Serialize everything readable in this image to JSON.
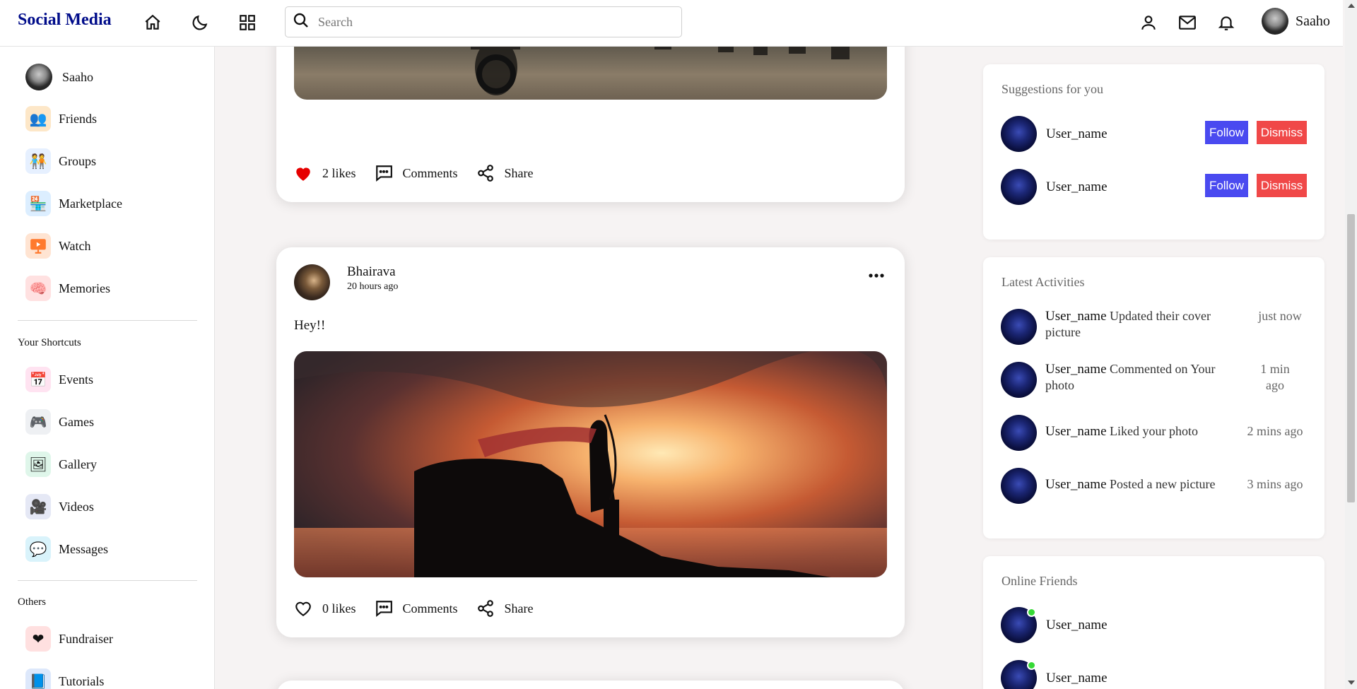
{
  "app": {
    "logo": "Social Media"
  },
  "search": {
    "placeholder": "Search"
  },
  "header_user": {
    "name": "Saaho"
  },
  "sidebar": {
    "profile": {
      "name": "Saaho"
    },
    "main_items": [
      {
        "label": "Friends",
        "icon": "friends-icon"
      },
      {
        "label": "Groups",
        "icon": "groups-icon"
      },
      {
        "label": "Marketplace",
        "icon": "marketplace-icon"
      },
      {
        "label": "Watch",
        "icon": "watch-icon"
      },
      {
        "label": "Memories",
        "icon": "memories-icon"
      }
    ],
    "shortcuts_heading": "Your Shortcuts",
    "shortcuts": [
      {
        "label": "Events",
        "icon": "events-icon"
      },
      {
        "label": "Games",
        "icon": "games-icon"
      },
      {
        "label": "Gallery",
        "icon": "gallery-icon"
      },
      {
        "label": "Videos",
        "icon": "videos-icon"
      },
      {
        "label": "Messages",
        "icon": "messages-icon"
      }
    ],
    "others_heading": "Others",
    "others": [
      {
        "label": "Fundraiser",
        "icon": "fundraiser-icon"
      },
      {
        "label": "Tutorials",
        "icon": "tutorials-icon"
      }
    ]
  },
  "posts": [
    {
      "likes": "2 likes",
      "liked": true,
      "comments_label": "Comments",
      "share_label": "Share"
    },
    {
      "author": "Bhairava",
      "time": "20 hours ago",
      "text": "Hey!!",
      "likes": "0 likes",
      "liked": false,
      "comments_label": "Comments",
      "share_label": "Share"
    }
  ],
  "suggestions": {
    "title": "Suggestions for you",
    "items": [
      {
        "name": "User_name",
        "follow": "Follow",
        "dismiss": "Dismiss"
      },
      {
        "name": "User_name",
        "follow": "Follow",
        "dismiss": "Dismiss"
      }
    ]
  },
  "activities": {
    "title": "Latest Activities",
    "items": [
      {
        "name": "User_name",
        "text": "Updated their cover picture",
        "time": "just now"
      },
      {
        "name": "User_name",
        "text": "Commented on Your photo",
        "time": "1 min ago"
      },
      {
        "name": "User_name",
        "text": "Liked your photo",
        "time": "2 mins ago"
      },
      {
        "name": "User_name",
        "text": "Posted a new picture",
        "time": "3 mins ago"
      }
    ]
  },
  "online_friends": {
    "title": "Online Friends",
    "items": [
      {
        "name": "User_name"
      },
      {
        "name": "User_name"
      }
    ]
  },
  "colors": {
    "brand": "#000c8a",
    "follow": "#4a4af0",
    "dismiss": "#f04848",
    "online": "#36d936",
    "like": "#e60000"
  }
}
